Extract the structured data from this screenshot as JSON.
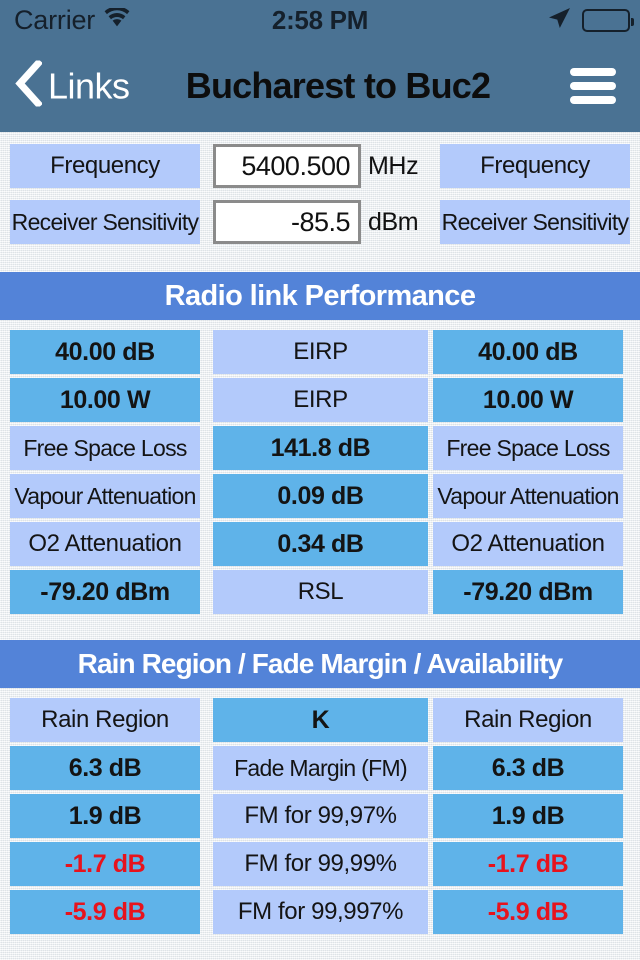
{
  "status_bar": {
    "carrier": "Carrier",
    "wifi_icon": "wifi-icon",
    "time": "2:58 PM",
    "location_icon": "location-arrow-icon",
    "battery_icon": "battery-full-icon"
  },
  "nav": {
    "back_icon": "chevron-left-icon",
    "back_label": "Links",
    "title": "Bucharest to Buc2",
    "menu_icon": "hamburger-menu-icon"
  },
  "inputs": {
    "rows": [
      {
        "left_label": "Frequency",
        "value": "5400.500",
        "placeholder": "5400.500",
        "unit": "MHz",
        "right_label": "Frequency"
      },
      {
        "left_label": "Receiver Sensitivity",
        "value": "-85.5",
        "placeholder": "-85.5",
        "unit": "dBm",
        "right_label": "Receiver Sensitivity"
      }
    ]
  },
  "sections": [
    {
      "title": "Radio link Performance",
      "rows": [
        {
          "left": "40.00 dB",
          "left_type": "val",
          "center": "EIRP",
          "center_type": "lab",
          "right": "40.00 dB",
          "right_type": "val"
        },
        {
          "left": "10.00 W",
          "left_type": "val",
          "center": "EIRP",
          "center_type": "lab",
          "right": "10.00 W",
          "right_type": "val"
        },
        {
          "left": "Free Space Loss",
          "left_type": "lab",
          "center": "141.8 dB",
          "center_type": "val",
          "right": "Free Space Loss",
          "right_type": "lab"
        },
        {
          "left": "Vapour Attenuation",
          "left_type": "lab",
          "center": "0.09 dB",
          "center_type": "val",
          "right": "Vapour Attenuation",
          "right_type": "lab"
        },
        {
          "left": "O2 Attenuation",
          "left_type": "lab",
          "center": "0.34 dB",
          "center_type": "val",
          "right": "O2 Attenuation",
          "right_type": "lab"
        },
        {
          "left": "-79.20 dBm",
          "left_type": "val",
          "center": "RSL",
          "center_type": "lab",
          "right": "-79.20 dBm",
          "right_type": "val"
        }
      ]
    },
    {
      "title": "Rain Region / Fade Margin / Availability",
      "rows": [
        {
          "left": "Rain Region",
          "left_type": "lab",
          "center": "K",
          "center_type": "val",
          "right": "Rain Region",
          "right_type": "lab"
        },
        {
          "left": "6.3 dB",
          "left_type": "val",
          "center": "Fade Margin (FM)",
          "center_type": "lab",
          "right": "6.3 dB",
          "right_type": "val"
        },
        {
          "left": "1.9 dB",
          "left_type": "val",
          "center": "FM for 99,97%",
          "center_type": "lab",
          "right": "1.9 dB",
          "right_type": "val"
        },
        {
          "left": "-1.7 dB",
          "left_type": "val red",
          "center": "FM for 99,99%",
          "center_type": "lab",
          "right": "-1.7 dB",
          "right_type": "val red"
        },
        {
          "left": "-5.9 dB",
          "left_type": "val red",
          "center": "FM for 99,997%",
          "center_type": "lab",
          "right": "-5.9 dB",
          "right_type": "val red"
        }
      ]
    }
  ],
  "colors": {
    "navbar": "#4a7293",
    "section_header": "#5383d8",
    "value_cell": "#5fb3e9",
    "label_cell": "#b3cafb",
    "negative_text": "#e7131d",
    "page_background": "#eef1f4"
  }
}
